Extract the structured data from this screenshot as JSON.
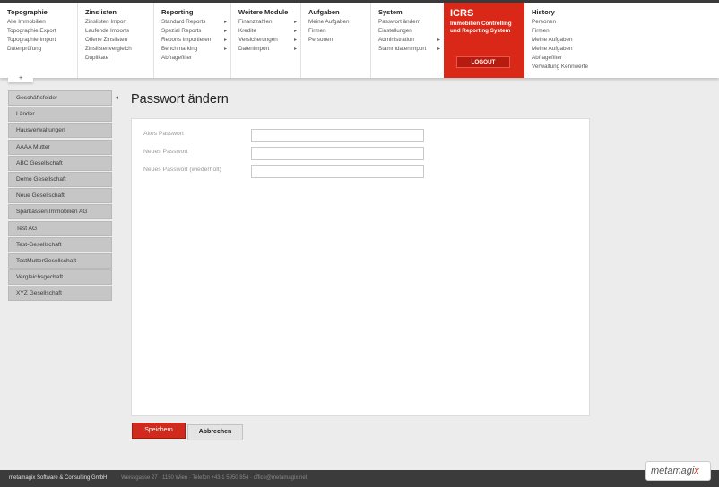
{
  "nav": {
    "columns": [
      {
        "title": "Topographie",
        "items": [
          {
            "label": "Alle Immobilien",
            "arrow": false
          },
          {
            "label": "Topographie Export",
            "arrow": false
          },
          {
            "label": "Topographie Import",
            "arrow": false
          },
          {
            "label": "Datenprüfung",
            "arrow": false
          }
        ]
      },
      {
        "title": "Zinslisten",
        "items": [
          {
            "label": "Zinslisten Import",
            "arrow": false
          },
          {
            "label": "Laufende Imports",
            "arrow": false
          },
          {
            "label": "Offene Zinslisten",
            "arrow": false
          },
          {
            "label": "Zinslistenvergleich",
            "arrow": false
          },
          {
            "label": "Duplikate",
            "arrow": false
          }
        ]
      },
      {
        "title": "Reporting",
        "items": [
          {
            "label": "Standard Reports",
            "arrow": true
          },
          {
            "label": "Spezial Reports",
            "arrow": true
          },
          {
            "label": "Reports importieren",
            "arrow": true
          },
          {
            "label": "Benchmarking",
            "arrow": true
          },
          {
            "label": "Abfragefilter",
            "arrow": false
          }
        ]
      },
      {
        "title": "Weitere Module",
        "items": [
          {
            "label": "Finanzzahlen",
            "arrow": true
          },
          {
            "label": "Kredite",
            "arrow": true
          },
          {
            "label": "Versicherungen",
            "arrow": true
          },
          {
            "label": "Datenimport",
            "arrow": true
          }
        ]
      },
      {
        "title": "Aufgaben",
        "items": [
          {
            "label": "Meine Aufgaben",
            "arrow": false
          },
          {
            "label": "Firmen",
            "arrow": false
          },
          {
            "label": "Personen",
            "arrow": false
          }
        ]
      },
      {
        "title": "System",
        "items": [
          {
            "label": "Passwort ändern",
            "arrow": false
          },
          {
            "label": "Einstellungen",
            "arrow": false
          },
          {
            "label": "Administration",
            "arrow": true
          },
          {
            "label": "Stammdatenimport",
            "arrow": true
          }
        ]
      }
    ],
    "icrs": {
      "title": "ICRS",
      "subtitle_line1": "Immobilien Controlling",
      "subtitle_line2": "und Reporting System",
      "logout_label": "LOGOUT"
    },
    "history": {
      "title": "History",
      "items": [
        "Personen",
        "Firmen",
        "Meine Aufgaben",
        "Meine Aufgaben",
        "Abfragefilter",
        "Verwaltung Kennwerte"
      ]
    },
    "plus_tab": "+"
  },
  "sidebar": {
    "items": [
      "Geschäftsfelder",
      "Länder",
      "Hausverwaltungen",
      "AAAA Mutter",
      "ABC Gesellschaft",
      "Demo Gesellschaft",
      "Neue Gesellschaft",
      "Sparkassen Immobilien AG",
      "Test AG",
      "Test-Gesellschaft",
      "TestMutterGesellschaft",
      "Vergleichsgechaft",
      "XYZ Gesellschaft"
    ],
    "active_index": 0,
    "active_marker": "◂"
  },
  "page": {
    "title": "Passwort ändern"
  },
  "form": {
    "old_password_label": "Altes Passwort",
    "new_password_label": "Neues Passwort",
    "repeat_password_label": "Neues Passwort (wiederholt)",
    "old_password_value": "",
    "new_password_value": "",
    "repeat_password_value": ""
  },
  "buttons": {
    "save_label": "Speichern",
    "cancel_label": "Abbrechen"
  },
  "footer": {
    "company": "metamagix Software & Consulting GmbH",
    "address": "Weissgasse 27 · 1150 Wien · Telefon +43 1 5950 854 · office@metamagix.net"
  },
  "logo": {
    "text": "metamagi",
    "accent": "x"
  },
  "colors": {
    "accent": "#d92718",
    "sidebar": "#c6c6c6",
    "footer": "#3b3b3b"
  }
}
